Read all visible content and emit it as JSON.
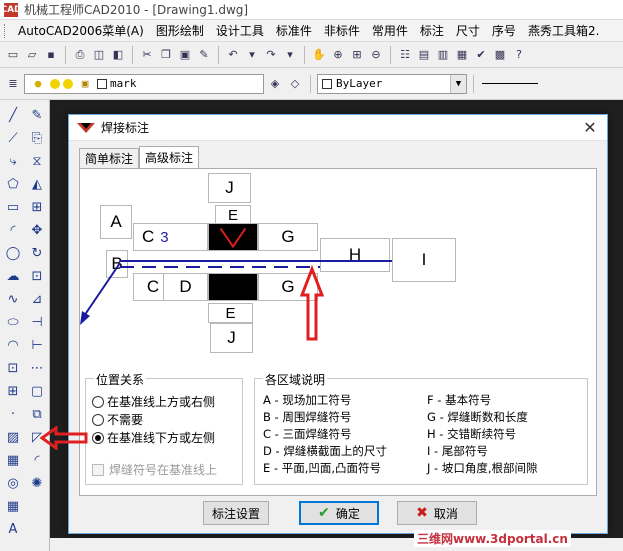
{
  "window": {
    "title": "机械工程师CAD2010 - [Drawing1.dwg]",
    "app_logo": "CAD"
  },
  "menubar": {
    "items": [
      "AutoCAD2006菜单(A)",
      "图形绘制",
      "设计工具",
      "标准件",
      "非标件",
      "常用件",
      "标注",
      "尺寸",
      "序号",
      "燕秀工具箱2."
    ]
  },
  "layer_bar": {
    "layer_name": "mark",
    "linetype": "ByLayer"
  },
  "dialog": {
    "title": "焊接标注",
    "close_glyph": "✕",
    "tabs": [
      "简单标注",
      "高级标注"
    ],
    "active_tab": "高级标注",
    "diagram": {
      "top": {
        "J": "J",
        "E": "E",
        "C": "C",
        "C_value": "3",
        "G": "G"
      },
      "side": {
        "A": "A",
        "B": "B",
        "H": "H",
        "I": "I"
      },
      "bottom": {
        "C": "C",
        "D": "D",
        "G": "G",
        "E": "E",
        "J": "J"
      }
    },
    "position_group": {
      "title": "位置关系",
      "options": [
        "在基准线上方或右侧",
        "不需要",
        "在基准线下方或左侧"
      ],
      "selected_index": 2,
      "checkbox_label": "焊缝符号在基准线上",
      "checkbox_checked": false
    },
    "legend_group": {
      "title": "各区域说明",
      "left": [
        "A - 现场加工符号",
        "B - 周围焊缝符号",
        "C - 三面焊缝符号",
        "D - 焊缝横截面上的尺寸",
        "E - 平面,凹面,凸面符号"
      ],
      "right": [
        "F - 基本符号",
        "G - 焊缝断数和长度",
        "H - 交错断续符号",
        "I - 尾部符号",
        "J - 坡口角度,根部间隙"
      ]
    },
    "buttons": {
      "settings": "标注设置",
      "ok": "确定",
      "cancel": "取消"
    }
  },
  "watermark": "三维网www.3dportal.cn",
  "colors": {
    "accent_blue": "#0078d7",
    "annotation_red": "#e02020",
    "reference_line": "#1a1aa0"
  }
}
